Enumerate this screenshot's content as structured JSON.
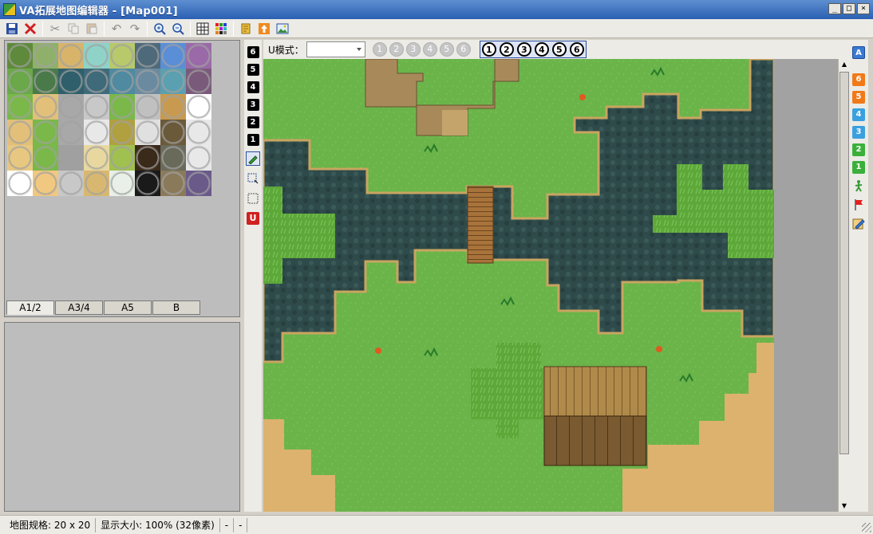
{
  "window": {
    "title": "VA拓展地图编辑器 - [Map001]",
    "minimize": "_",
    "maximize": "□",
    "close": "×"
  },
  "toolbar": {
    "icons": [
      "save-icon",
      "delete-icon",
      "cut-icon",
      "copy-icon",
      "paste-icon",
      "undo-icon",
      "redo-icon",
      "zoom-in-icon",
      "zoom-out-icon",
      "grid-icon",
      "palette-icon",
      "script-icon",
      "upload-icon",
      "image-icon"
    ]
  },
  "tileset": {
    "tabs": [
      "A1/2",
      "A3/4",
      "A5",
      "B"
    ],
    "active_tab": "A1/2",
    "tile_colors": [
      "#5f8a3c",
      "#8fb06a",
      "#d7b46a",
      "#8fd3c8",
      "#b7c96a",
      "#4e6a7a",
      "#5a8ed6",
      "#9a6aa8",
      "#6aa84a",
      "#4a7a4a",
      "#2f5f6a",
      "#3f6a7a",
      "#4f8aa0",
      "#6a8aa0",
      "#5aa0b0",
      "#7a5a7a",
      "#7ab84a",
      "#e2c07a",
      "#a8a8a8",
      "#c8c8c8",
      "#7ab84a",
      "#c0c0c0",
      "#c89a50",
      "#ffffff",
      "#e2c07a",
      "#7ab84a",
      "#a8a8a8",
      "#e8e8e8",
      "#b0a040",
      "#e0e0e0",
      "#6a5a3a",
      "#e8e8e8",
      "#e8c880",
      "#7ab84a",
      "#a0a0a0",
      "#e8d8a0",
      "#a0c050",
      "#3a2a1a",
      "#6a6a5a",
      "#e8e8e8",
      "#ffffff",
      "#f0c880",
      "#c8c8c8",
      "#d8b870",
      "#e8f0e8",
      "#1a1a1a",
      "#8a7a5a",
      "#6a5a8a"
    ]
  },
  "layers_left": {
    "numbers": [
      "6",
      "5",
      "4",
      "3",
      "2",
      "1"
    ],
    "tools": [
      "pencil-icon",
      "rect-select-icon",
      "marquee-icon",
      "u-tool-icon"
    ],
    "u_label": "U"
  },
  "mode_bar": {
    "label": "U模式：",
    "select_value": "",
    "disabled_circles": [
      "1",
      "2",
      "3",
      "4",
      "5",
      "6"
    ],
    "active_circles": [
      "1",
      "2",
      "3",
      "4",
      "5",
      "6"
    ]
  },
  "layers_right": {
    "top_label": "A",
    "numbers": [
      {
        "n": "6",
        "color": "#f07a1a"
      },
      {
        "n": "5",
        "color": "#f07a1a"
      },
      {
        "n": "4",
        "color": "#3aa0e0"
      },
      {
        "n": "3",
        "color": "#3aa0e0"
      },
      {
        "n": "2",
        "color": "#3ab03a"
      },
      {
        "n": "1",
        "color": "#3ab03a"
      }
    ],
    "tools": [
      "walker-icon",
      "flag-icon",
      "edit-icon"
    ]
  },
  "map": {
    "colors": {
      "grass": "#6ab44a",
      "water": "#2f4a4a",
      "dirt": "#dcb26e",
      "bridge": "#a8733a",
      "cliff": "#a88a5a",
      "bush": "#5ea83a",
      "roof": "#b08a4a",
      "wall": "#8a6a3a"
    }
  },
  "statusbar": {
    "size": "地图规格: 20 x 20",
    "zoom": "显示大小: 100% (32像素)",
    "a": "-",
    "b": "-"
  }
}
